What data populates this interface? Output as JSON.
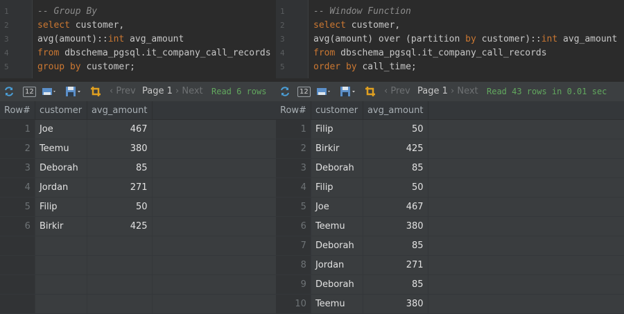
{
  "left": {
    "editor": {
      "lines": [
        {
          "n": "1",
          "code": [
            {
              "t": "-- Group By",
              "c": "cm"
            }
          ]
        },
        {
          "n": "2",
          "code": [
            {
              "t": "select",
              "c": "kw"
            },
            {
              "t": " customer,",
              "c": ""
            }
          ]
        },
        {
          "n": "3",
          "code": [
            {
              "t": "avg(amount)::",
              "c": ""
            },
            {
              "t": "int",
              "c": "kw"
            },
            {
              "t": " avg_amount",
              "c": ""
            }
          ]
        },
        {
          "n": "4",
          "code": [
            {
              "t": "from",
              "c": "kw"
            },
            {
              "t": " dbschema_pgsql.it_company_call_records",
              "c": ""
            }
          ]
        },
        {
          "n": "5",
          "code": [
            {
              "t": "group by",
              "c": "kw"
            },
            {
              "t": " customer;",
              "c": ""
            }
          ]
        }
      ]
    },
    "toolbar": {
      "rows_count": "12",
      "prev": "Prev",
      "page": "Page 1",
      "next": "Next",
      "status": "Read 6 rows"
    },
    "grid": {
      "headers": [
        "Row#",
        "customer",
        "avg_amount"
      ],
      "rows": [
        [
          "1",
          "Joe",
          "467"
        ],
        [
          "2",
          "Teemu",
          "380"
        ],
        [
          "3",
          "Deborah",
          "85"
        ],
        [
          "4",
          "Jordan",
          "271"
        ],
        [
          "5",
          "Filip",
          "50"
        ],
        [
          "6",
          "Birkir",
          "425"
        ]
      ],
      "empty_rows": 4
    }
  },
  "right": {
    "editor": {
      "lines": [
        {
          "n": "1",
          "code": [
            {
              "t": "-- Window Function",
              "c": "cm"
            }
          ]
        },
        {
          "n": "2",
          "code": [
            {
              "t": "select",
              "c": "kw"
            },
            {
              "t": " customer,",
              "c": ""
            }
          ]
        },
        {
          "n": "3",
          "code": [
            {
              "t": "avg(amount) over (partition ",
              "c": ""
            },
            {
              "t": "by",
              "c": "kw"
            },
            {
              "t": " customer)::",
              "c": ""
            },
            {
              "t": "int",
              "c": "kw"
            },
            {
              "t": " avg_amount",
              "c": ""
            }
          ]
        },
        {
          "n": "4",
          "code": [
            {
              "t": "from",
              "c": "kw"
            },
            {
              "t": " dbschema_pgsql.it_company_call_records",
              "c": ""
            }
          ]
        },
        {
          "n": "5",
          "code": [
            {
              "t": "order by",
              "c": "kw"
            },
            {
              "t": " call_time;",
              "c": ""
            }
          ]
        }
      ]
    },
    "toolbar": {
      "rows_count": "12",
      "prev": "Prev",
      "page": "Page 1",
      "next": "Next",
      "status": "Read 43 rows in 0.01 sec"
    },
    "grid": {
      "headers": [
        "Row#",
        "customer",
        "avg_amount"
      ],
      "rows": [
        [
          "1",
          "Filip",
          "50"
        ],
        [
          "2",
          "Birkir",
          "425"
        ],
        [
          "3",
          "Deborah",
          "85"
        ],
        [
          "4",
          "Filip",
          "50"
        ],
        [
          "5",
          "Joe",
          "467"
        ],
        [
          "6",
          "Teemu",
          "380"
        ],
        [
          "7",
          "Deborah",
          "85"
        ],
        [
          "8",
          "Jordan",
          "271"
        ],
        [
          "9",
          "Deborah",
          "85"
        ],
        [
          "10",
          "Teemu",
          "380"
        ]
      ],
      "empty_rows": 0
    }
  },
  "colors": {
    "keyword": "#cc7832",
    "comment": "#8c8c8c",
    "status": "#62a85e",
    "background": "#2b2b2b"
  }
}
